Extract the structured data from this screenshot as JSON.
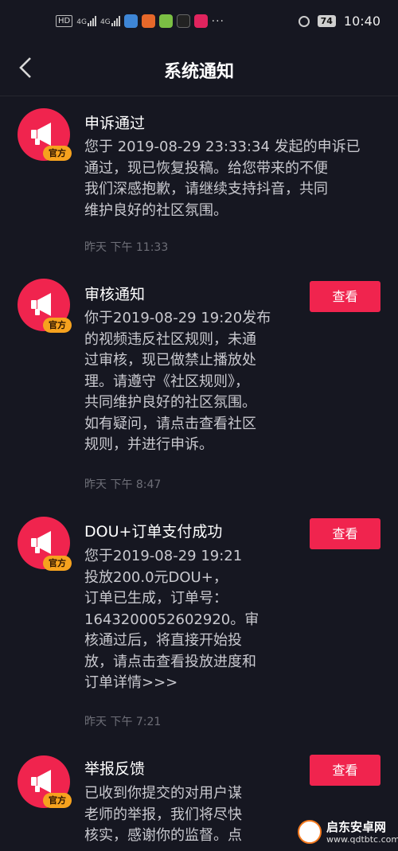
{
  "status_bar": {
    "hd_label": "HD",
    "signal1": "4G",
    "signal2": "4G",
    "battery": "74",
    "time": "10:40",
    "more": "···"
  },
  "header": {
    "title": "系统通知"
  },
  "colors": {
    "accent": "#f0244e",
    "badge": "#f6a21e",
    "background": "#161721"
  },
  "messages": [
    {
      "title": "申诉通过",
      "lines": [
        "您于 2019-08-29 23:33:34 发起的申诉已",
        "通过，现已恢复投稿。给您带来的不便",
        "我们深感抱歉，请继续支持抖音，共同",
        "维护良好的社区氛围。"
      ],
      "time": "昨天 下午 11:33",
      "badge": "官方"
    },
    {
      "title": "审核通知",
      "lines": [
        "你于2019-08-29 19:20发布",
        "的视频违反社区规则，未通",
        "过审核，现已做禁止播放处",
        "理。请遵守《社区规则》，",
        "共同维护良好的社区氛围。",
        "如有疑问，请点击查看社区",
        "规则，并进行申诉。"
      ],
      "time": "昨天 下午 8:47",
      "badge": "官方",
      "button": "查看"
    },
    {
      "title": "DOU+订单支付成功",
      "lines": [
        "您于2019-08-29 19:21",
        "投放200.0元DOU+，",
        "订单已生成，订单号：",
        "1643200052602920。审",
        "核通过后，将直接开始投",
        "放，请点击查看投放进度和",
        "订单详情>>>"
      ],
      "time": "昨天 下午 7:21",
      "badge": "官方",
      "button": "查看"
    },
    {
      "title": "举报反馈",
      "lines": [
        "已收到你提交的对用户谋",
        "老师的举报，我们将尽快",
        "核实，感谢你的监督。点"
      ],
      "badge": "官方",
      "button": "查看"
    }
  ],
  "watermark": {
    "name": "启东安卓网",
    "url": "www.qdtbtc.com"
  }
}
